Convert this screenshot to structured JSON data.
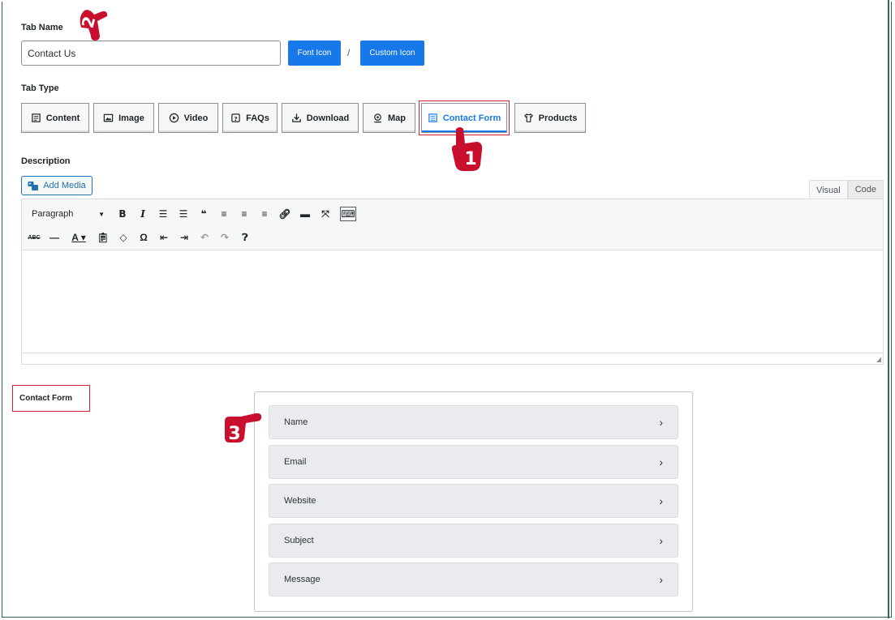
{
  "tab_name": {
    "label": "Tab Name",
    "value": "Contact Us",
    "font_icon_button": "Font Icon",
    "separator": "/",
    "custom_icon_button": "Custom Icon"
  },
  "tab_type": {
    "label": "Tab Type",
    "selected": "Contact Form",
    "options": [
      {
        "label": "Content",
        "icon": "content-icon"
      },
      {
        "label": "Image",
        "icon": "image-icon"
      },
      {
        "label": "Video",
        "icon": "play-icon"
      },
      {
        "label": "FAQs",
        "icon": "faq-icon"
      },
      {
        "label": "Download",
        "icon": "download-icon"
      },
      {
        "label": "Map",
        "icon": "map-pin-icon"
      },
      {
        "label": "Contact Form",
        "icon": "form-icon"
      },
      {
        "label": "Products",
        "icon": "shirt-icon"
      }
    ]
  },
  "description": {
    "label": "Description",
    "add_media": "Add Media",
    "editor_tabs": {
      "visual": "Visual",
      "code": "Code"
    },
    "format_select": "Paragraph"
  },
  "contact_form": {
    "label": "Contact Form",
    "fields": [
      "Name",
      "Email",
      "Website",
      "Subject",
      "Message"
    ]
  },
  "annotations": {
    "one": "1",
    "two": "2",
    "three": "3"
  },
  "colors": {
    "primary_button": "#1779e9",
    "highlight": "#d6202f",
    "frame": "#2e6b4f"
  }
}
